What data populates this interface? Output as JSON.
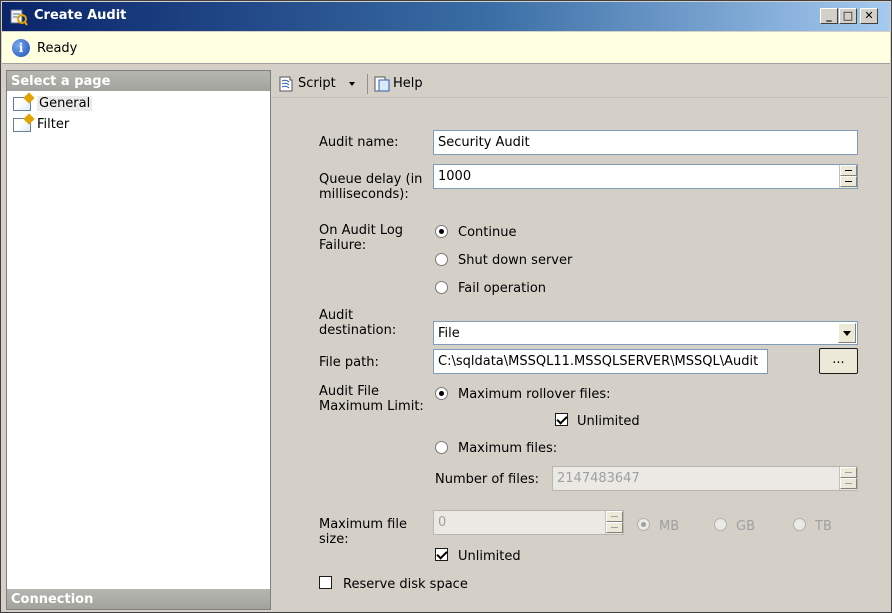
{
  "window": {
    "title": "Create Audit",
    "minimize": "_",
    "maximize": "□",
    "close": "✕"
  },
  "status": {
    "text": "Ready"
  },
  "left_pane": {
    "header": "Select a page",
    "pages": [
      {
        "label": "General",
        "selected": true
      },
      {
        "label": "Filter",
        "selected": false
      }
    ],
    "footer": "Connection"
  },
  "toolbar": {
    "script_label": "Script",
    "help_label": "Help"
  },
  "form": {
    "audit_name": {
      "label": "Audit name:",
      "value": "Security Audit"
    },
    "queue_delay": {
      "label_line1": "Queue delay (in",
      "label_line2": "milliseconds):",
      "value": "1000"
    },
    "on_failure": {
      "label_line1": "On Audit Log",
      "label_line2": "Failure:",
      "options": [
        {
          "label": "Continue",
          "selected": true
        },
        {
          "label": "Shut down server",
          "selected": false
        },
        {
          "label": "Fail operation",
          "selected": false
        }
      ]
    },
    "destination": {
      "label_line1": "Audit",
      "label_line2": "destination:",
      "value": "File"
    },
    "file_path": {
      "label": "File path:",
      "value": "C:\\sqldata\\MSSQL11.MSSQLSERVER\\MSSQL\\Audit",
      "browse_label": "..."
    },
    "max_limit": {
      "label_line1": "Audit File",
      "label_line2": "Maximum Limit:",
      "rollover_label": "Maximum rollover files:",
      "rollover_selected": true,
      "unlimited_label": "Unlimited",
      "unlimited_checked": true,
      "max_files_label": "Maximum files:",
      "max_files_selected": false,
      "number_of_files_label": "Number of files:",
      "number_of_files_value": "2147483647"
    },
    "max_file_size": {
      "label_line1": "Maximum file",
      "label_line2": "size:",
      "value": "0",
      "units": [
        {
          "label": "MB",
          "selected": true
        },
        {
          "label": "GB",
          "selected": false
        },
        {
          "label": "TB",
          "selected": false
        }
      ],
      "unlimited_label": "Unlimited",
      "unlimited_checked": true
    },
    "reserve_disk": {
      "label": "Reserve disk space",
      "checked": false
    }
  }
}
